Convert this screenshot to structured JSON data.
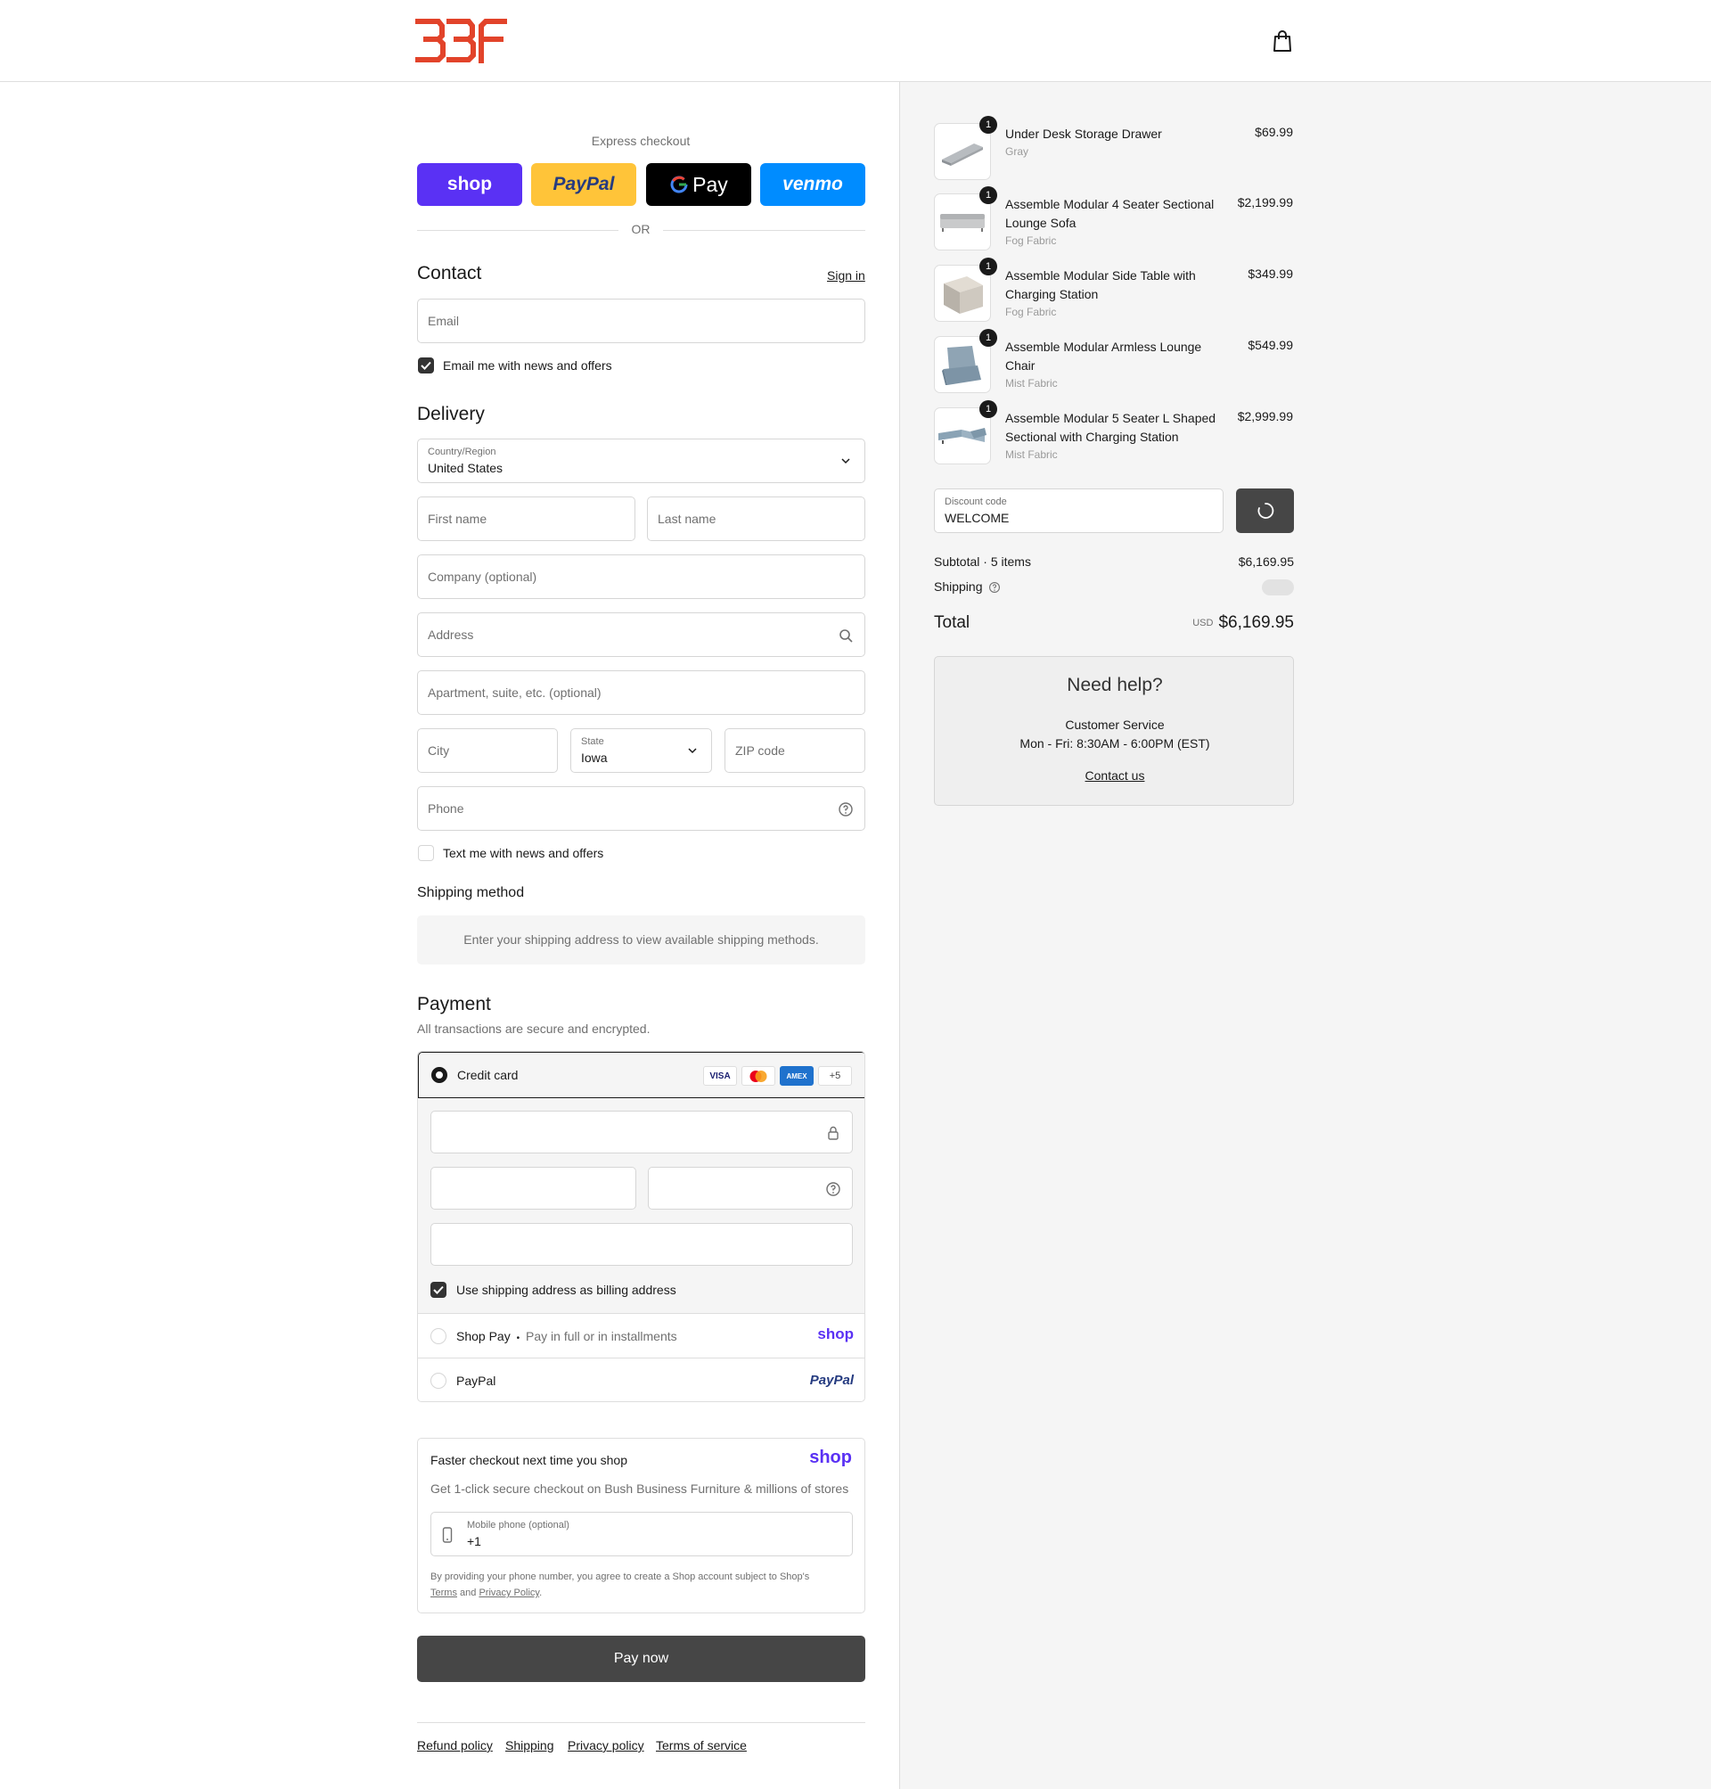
{
  "brand": {
    "logo_text": "BBF",
    "color": "#e2432a"
  },
  "express": {
    "label": "Express checkout",
    "buttons": [
      {
        "name": "shop",
        "label": "shop",
        "bg": "#5a31f4",
        "fg": "#ffffff"
      },
      {
        "name": "paypal",
        "label": "PayPal",
        "bg": "#ffc439",
        "fg": "#253b80"
      },
      {
        "name": "gpay",
        "label": "Pay",
        "bg": "#000000",
        "fg": "#ffffff"
      },
      {
        "name": "venmo",
        "label": "venmo",
        "bg": "#008cff",
        "fg": "#ffffff"
      }
    ],
    "or_label": "OR"
  },
  "contact": {
    "title": "Contact",
    "sign_in": "Sign in",
    "email_placeholder": "Email",
    "email_news_label": "Email me with news and offers",
    "email_news_checked": true
  },
  "delivery": {
    "title": "Delivery",
    "country_label": "Country/Region",
    "country_value": "United States",
    "first_name_placeholder": "First name",
    "last_name_placeholder": "Last name",
    "company_placeholder": "Company (optional)",
    "address_placeholder": "Address",
    "apartment_placeholder": "Apartment, suite, etc. (optional)",
    "city_placeholder": "City",
    "state_label": "State",
    "state_value": "Iowa",
    "zip_placeholder": "ZIP code",
    "phone_placeholder": "Phone",
    "text_news_label": "Text me with news and offers",
    "text_news_checked": false
  },
  "shipping_method": {
    "title": "Shipping method",
    "notice": "Enter your shipping address to view available shipping methods."
  },
  "payment": {
    "title": "Payment",
    "subtitle": "All transactions are secure and encrypted.",
    "credit_card_label": "Credit card",
    "card_icons": [
      "VISA",
      "mastercard",
      "AMEX",
      "+5"
    ],
    "billing_same_label": "Use shipping address as billing address",
    "billing_same_checked": true,
    "shop_pay_label": "Shop Pay",
    "shop_pay_bullet": "•",
    "shop_pay_sub": "Pay in full or in installments",
    "shop_pay_logo": "shop",
    "paypal_label": "PayPal",
    "paypal_logo": "PayPal"
  },
  "shop_promo": {
    "title": "Faster checkout next time you shop",
    "logo": "shop",
    "subtitle": "Get 1-click secure checkout on Bush Business Furniture & millions of stores",
    "phone_label": "Mobile phone (optional)",
    "phone_value": "+1",
    "legal_prefix": "By providing your phone number, you agree to create a Shop account subject to Shop's",
    "terms": "Terms",
    "and": "and",
    "privacy": "Privacy Policy",
    "period": "."
  },
  "pay_now": "Pay now",
  "footer_links": [
    "Refund policy",
    "Shipping",
    "Privacy policy",
    "Terms of service"
  ],
  "order": {
    "items": [
      {
        "qty": "1",
        "name": "Under Desk Storage Drawer",
        "variant": "Gray",
        "price": "$69.99",
        "thumb": "drawer"
      },
      {
        "qty": "1",
        "name": "Assemble Modular 4 Seater Sectional Lounge Sofa",
        "variant": "Fog Fabric",
        "price": "$2,199.99",
        "thumb": "sofa"
      },
      {
        "qty": "1",
        "name": "Assemble Modular Side Table with Charging Station",
        "variant": "Fog Fabric",
        "price": "$349.99",
        "thumb": "side-table"
      },
      {
        "qty": "1",
        "name": "Assemble Modular Armless Lounge Chair",
        "variant": "Mist Fabric",
        "price": "$549.99",
        "thumb": "chair"
      },
      {
        "qty": "1",
        "name": "Assemble Modular 5 Seater L Shaped Sectional with Charging Station",
        "variant": "Mist Fabric",
        "price": "$2,999.99",
        "thumb": "l-sofa"
      }
    ],
    "discount_label": "Discount code",
    "discount_value": "WELCOME",
    "subtotal_label": "Subtotal · 5 items",
    "subtotal_value": "$6,169.95",
    "shipping_label": "Shipping",
    "total_label": "Total",
    "currency": "USD",
    "total_value": "$6,169.95"
  },
  "help": {
    "title": "Need help?",
    "line1": "Customer Service",
    "line2": "Mon - Fri: 8:30AM - 6:00PM (EST)",
    "contact": "Contact us"
  }
}
